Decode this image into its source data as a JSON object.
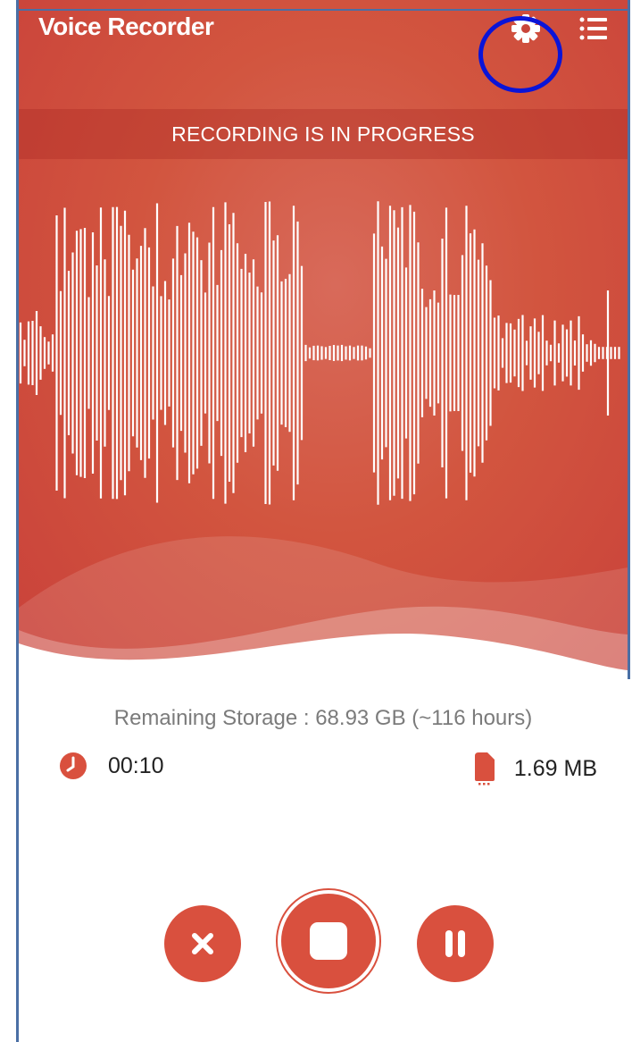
{
  "app": {
    "title": "Voice Recorder",
    "accent_color": "#d9503e",
    "annotation_color": "#0a14d8"
  },
  "toolbar": {
    "settings_icon": "gear-icon",
    "menu_icon": "list-icon"
  },
  "status": {
    "text": "RECORDING IS IN PROGRESS"
  },
  "storage": {
    "text": "Remaining Storage : 68.93 GB (~116 hours)"
  },
  "timer": {
    "icon": "clock-icon",
    "value": "00:10"
  },
  "file_size": {
    "icon": "sd-card-icon",
    "value": "1.69 MB"
  },
  "controls": {
    "cancel_icon": "close-icon",
    "stop_icon": "stop-icon",
    "pause_icon": "pause-icon"
  }
}
